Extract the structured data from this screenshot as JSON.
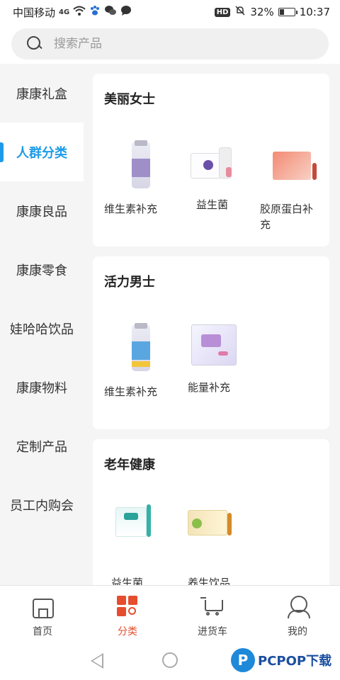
{
  "status_bar": {
    "carrier": "中国移动",
    "network": "4G",
    "battery_percent": "32%",
    "battery_level": 0.32,
    "time": "10:37",
    "hd": "HD"
  },
  "search": {
    "placeholder": "搜索产品"
  },
  "sidebar": {
    "items": [
      {
        "label": "康康礼盒"
      },
      {
        "label": "人群分类"
      },
      {
        "label": "康康良品"
      },
      {
        "label": "康康零食"
      },
      {
        "label": "娃哈哈饮品"
      },
      {
        "label": "康康物料"
      },
      {
        "label": "定制产品"
      },
      {
        "label": "员工内购会"
      }
    ],
    "active_index": 1,
    "accent_color": "#1e9be8"
  },
  "sections": [
    {
      "title": "美丽女士",
      "products": [
        {
          "name": "维生素补充",
          "icon": "vitamin-bottle-purple"
        },
        {
          "name": "益生菌",
          "icon": "probiotic-box"
        },
        {
          "name": "胶原蛋白补充",
          "icon": "collagen-box"
        }
      ]
    },
    {
      "title": "活力男士",
      "products": [
        {
          "name": "维生素补充",
          "icon": "vitamin-bottle-blue"
        },
        {
          "name": "能量补充",
          "icon": "energy-box"
        }
      ]
    },
    {
      "title": "老年健康",
      "products": [
        {
          "name": "益生菌",
          "icon": "probiotic-box-teal"
        },
        {
          "name": "养生饮品",
          "icon": "health-drink-box"
        }
      ]
    }
  ],
  "bottom_nav": {
    "items": [
      {
        "label": "首页",
        "icon": "home-icon"
      },
      {
        "label": "分类",
        "icon": "category-icon"
      },
      {
        "label": "进货车",
        "icon": "cart-icon"
      },
      {
        "label": "我的",
        "icon": "profile-icon"
      }
    ],
    "active_index": 1,
    "active_color": "#e54d2e"
  },
  "watermark": {
    "logo": "P",
    "text": "PCPOP下载"
  }
}
